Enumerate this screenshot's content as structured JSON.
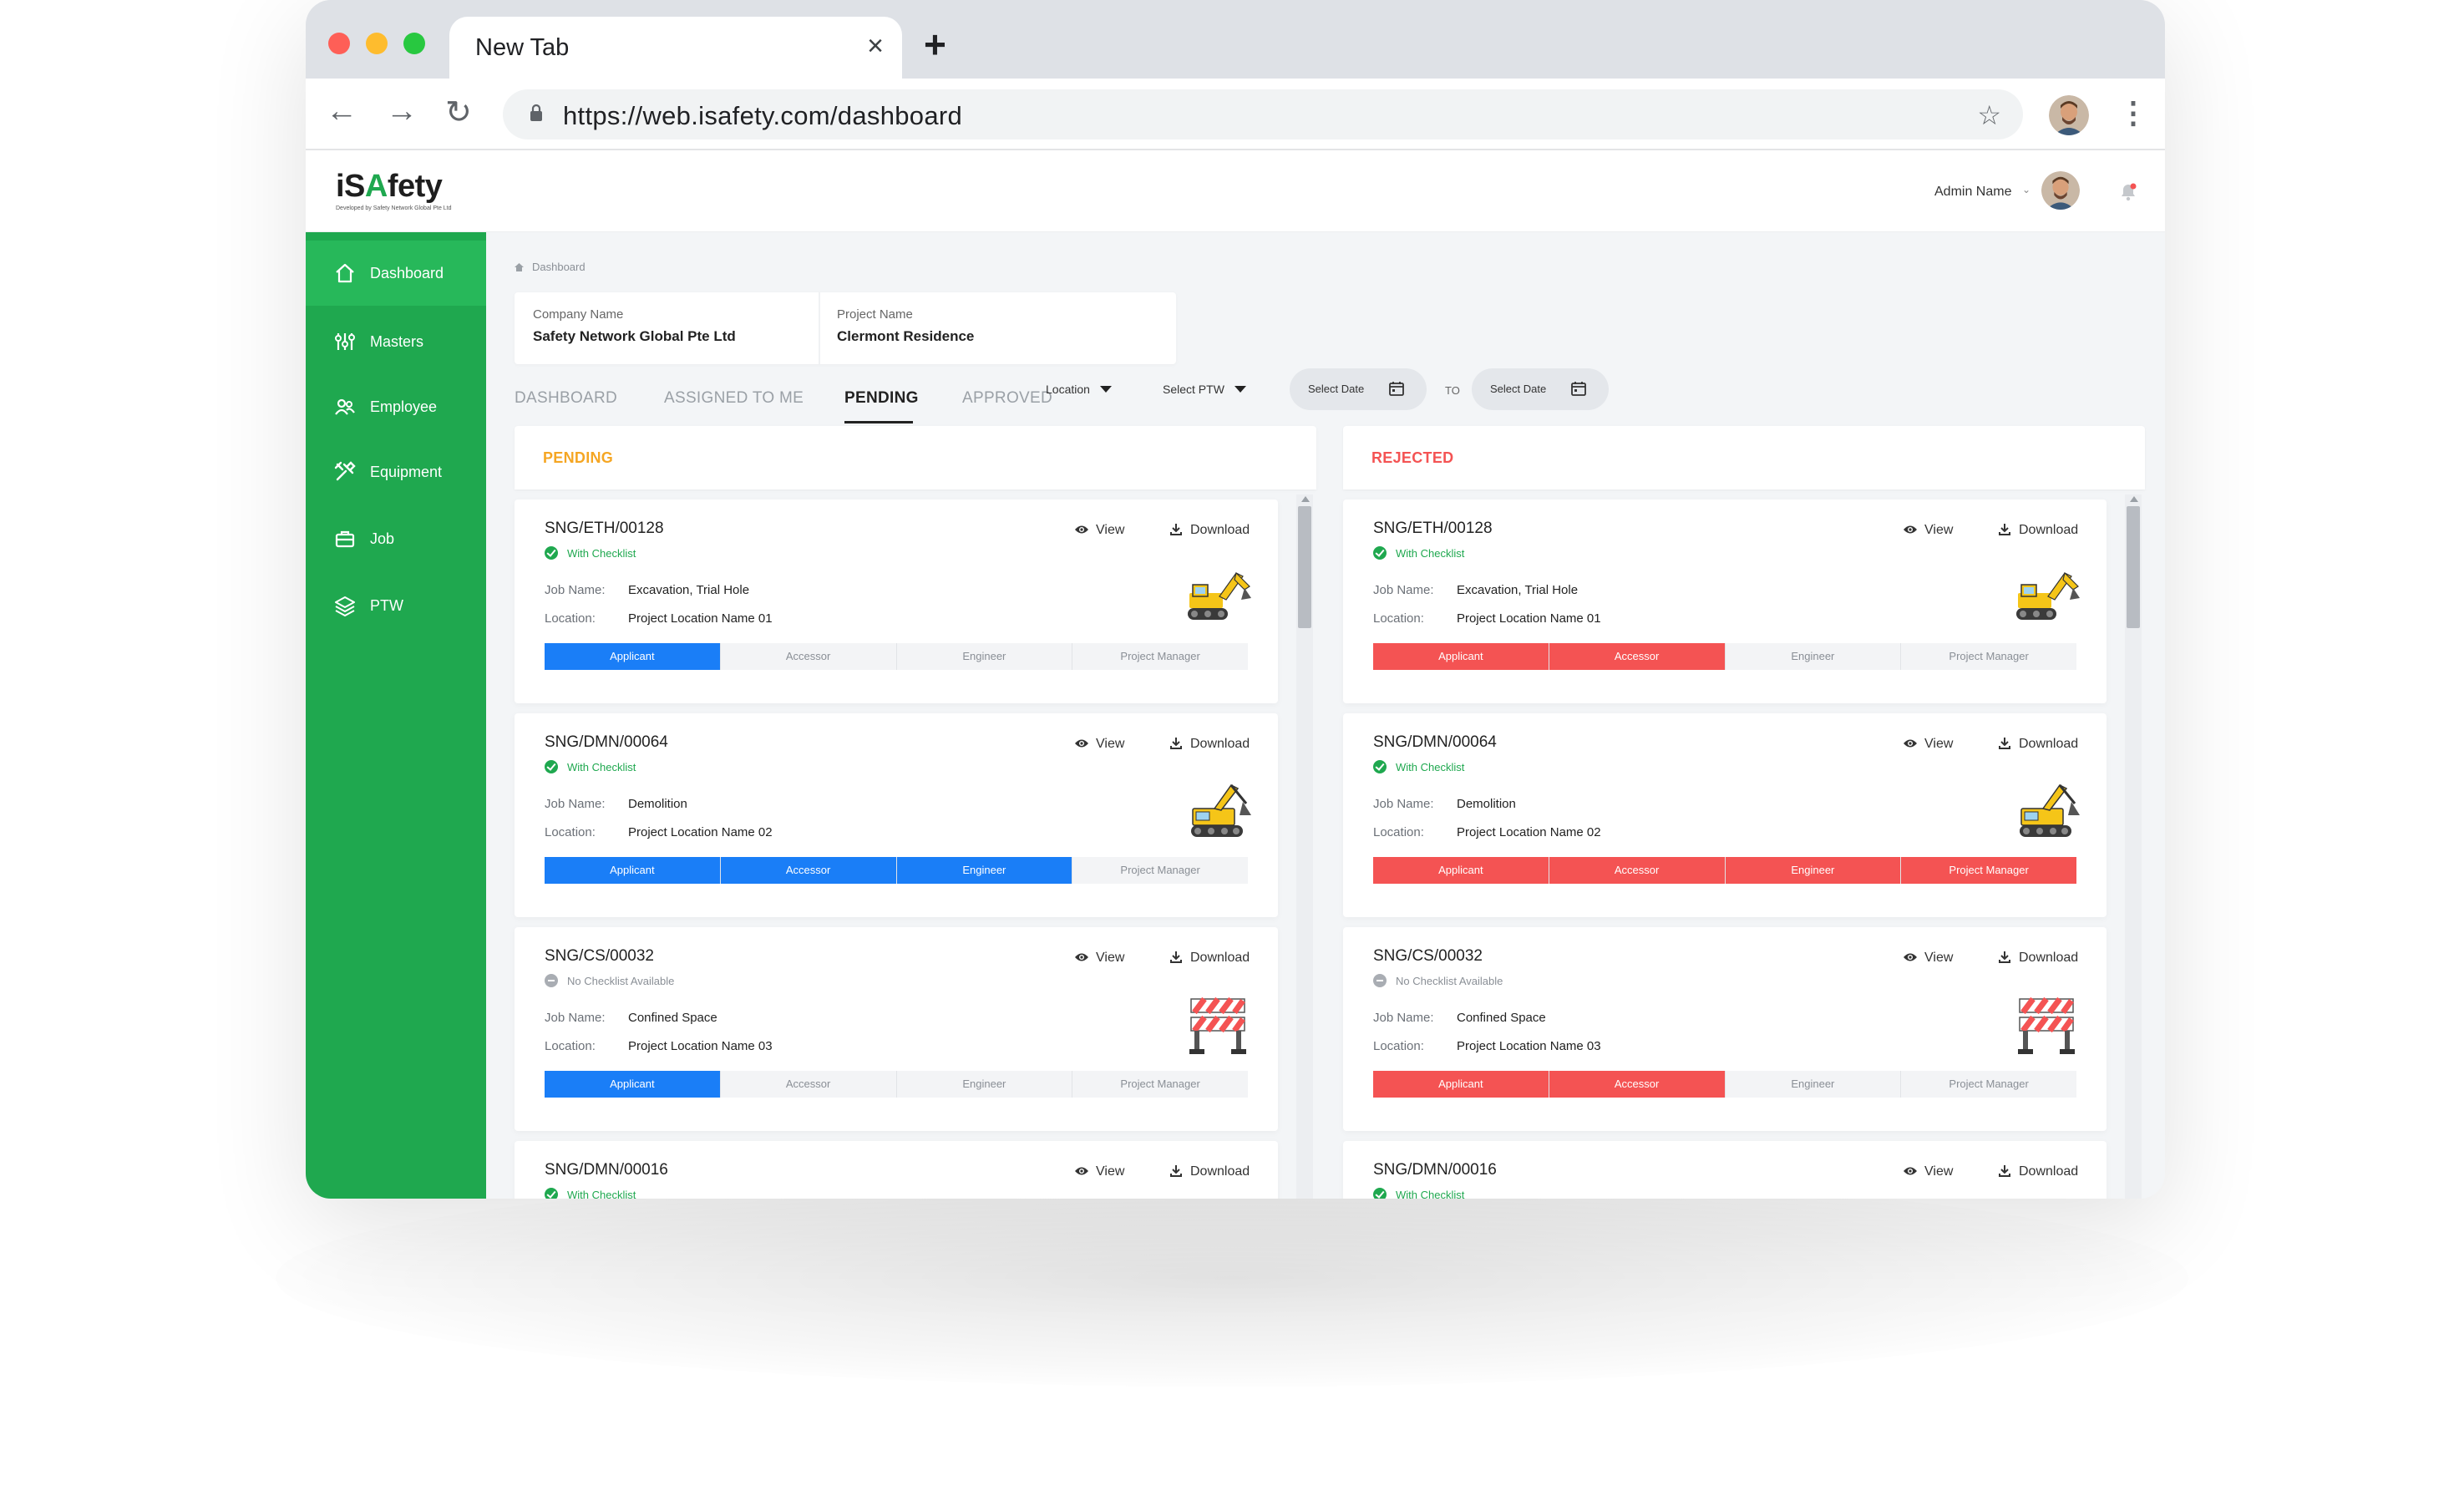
{
  "browser": {
    "tab_title": "New Tab",
    "tab_close": "×",
    "new_tab": "+",
    "url": "https://web.isafety.com/dashboard"
  },
  "header": {
    "logo_prefix": "iS",
    "logo_accent": "A",
    "logo_suffix": "fety",
    "logo_tagline": "Developed by Safety Network Global Pte Ltd",
    "admin_name": "Admin Name",
    "admin_caret": "⌄"
  },
  "sidebar": {
    "items": [
      {
        "label": "Dashboard",
        "icon": "home-icon"
      },
      {
        "label": "Masters",
        "icon": "sliders-icon"
      },
      {
        "label": "Employee",
        "icon": "users-icon"
      },
      {
        "label": "Equipment",
        "icon": "tools-icon"
      },
      {
        "label": "Job",
        "icon": "briefcase-icon"
      },
      {
        "label": "PTW",
        "icon": "layers-icon"
      }
    ]
  },
  "breadcrumb": "Dashboard",
  "info": {
    "company_label": "Company Name",
    "company_value": "Safety Network Global Pte Ltd",
    "project_label": "Project Name",
    "project_value": "Clermont Residence"
  },
  "tabs": [
    "DASHBOARD",
    "ASSIGNED TO ME",
    "PENDING",
    "APPROVED"
  ],
  "active_tab": "PENDING",
  "filters": {
    "location": "Location",
    "ptw": "Select PTW",
    "date_from": "Select Date",
    "to": "TO",
    "date_to": "Select Date"
  },
  "columns": {
    "pending_title": "PENDING",
    "rejected_title": "REJECTED"
  },
  "labels": {
    "job_name": "Job Name:",
    "location": "Location:",
    "view": "View",
    "download": "Download"
  },
  "stages": [
    "Applicant",
    "Accessor",
    "Engineer",
    "Project Manager"
  ],
  "pending_jobs": [
    {
      "id": "SNG/ETH/00128",
      "checklist": "With Checklist",
      "job_name": "Excavation, Trial Hole",
      "location": "Project Location Name 01",
      "done": 1
    },
    {
      "id": "SNG/DMN/00064",
      "checklist": "With Checklist",
      "job_name": "Demolition",
      "location": "Project Location Name 02",
      "done": 3
    },
    {
      "id": "SNG/CS/00032",
      "checklist": "No Checklist Available",
      "job_name": "Confined Space",
      "location": "Project Location Name 03",
      "done": 1
    },
    {
      "id": "SNG/DMN/00016",
      "checklist": "With Checklist"
    }
  ],
  "rejected_jobs": [
    {
      "id": "SNG/ETH/00128",
      "checklist": "With Checklist",
      "job_name": "Excavation, Trial Hole",
      "location": "Project Location Name 01",
      "done": 2
    },
    {
      "id": "SNG/DMN/00064",
      "checklist": "With Checklist",
      "job_name": "Demolition",
      "location": "Project Location Name 02",
      "done": 4
    },
    {
      "id": "SNG/CS/00032",
      "checklist": "No Checklist Available",
      "job_name": "Confined Space",
      "location": "Project Location Name 03",
      "done": 2
    },
    {
      "id": "SNG/DMN/00016",
      "checklist": "With Checklist"
    }
  ],
  "colors": {
    "brand_green": "#1fa84f",
    "pending_orange": "#f5a623",
    "rejected_red": "#f45353",
    "progress_blue": "#1a7ef7"
  }
}
